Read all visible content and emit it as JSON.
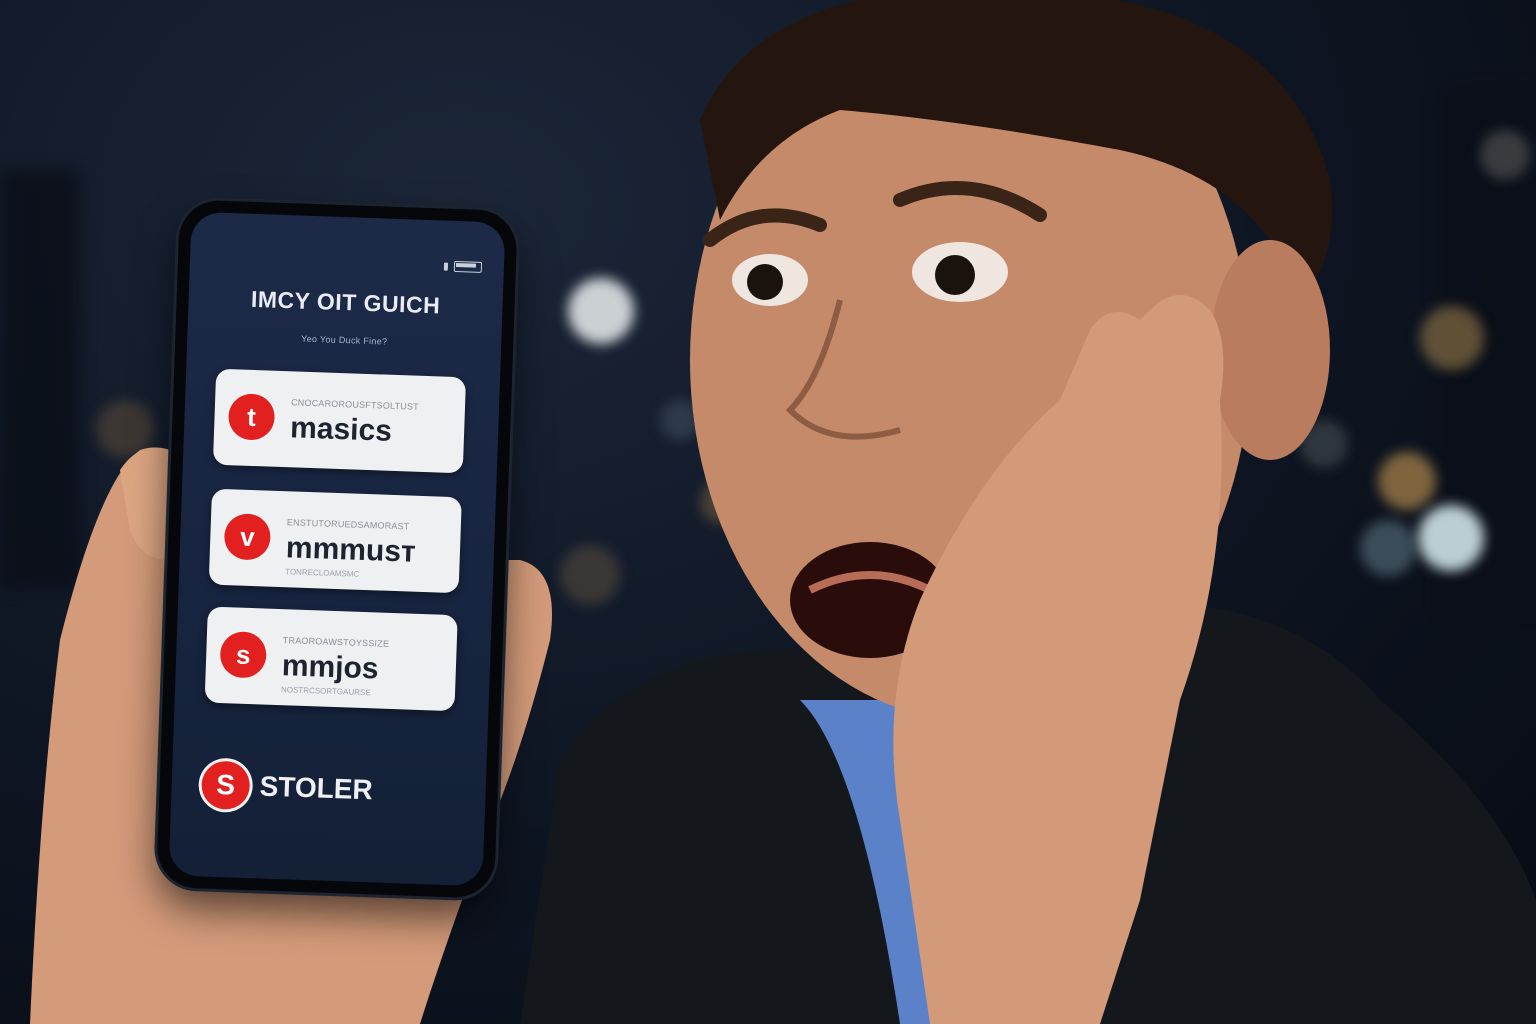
{
  "phone": {
    "title": "IMCY OIT GUICH",
    "subtitle": "Yeo You Duck Fine?",
    "cards": [
      {
        "icon": "t",
        "small_text": "CNOCAROROUSFTSOLTUST",
        "label": "masics",
        "bottom_text": ""
      },
      {
        "icon": "v",
        "small_text": "ENSTUTORUEDSAMORAST",
        "label": "mmmusт",
        "bottom_text": "TONRECLOAMSMC"
      },
      {
        "icon": "s",
        "small_text": "TRAOROAWSTOYSSIZE",
        "label": "mmjos",
        "bottom_text": "NOSTRCSORTGAURSE"
      }
    ],
    "bottom_item": {
      "icon": "S",
      "label": "STOLER"
    }
  },
  "colors": {
    "accent_red": "#e32020",
    "screen_navy": "#1c2a48",
    "card_white": "#eef0f2"
  }
}
